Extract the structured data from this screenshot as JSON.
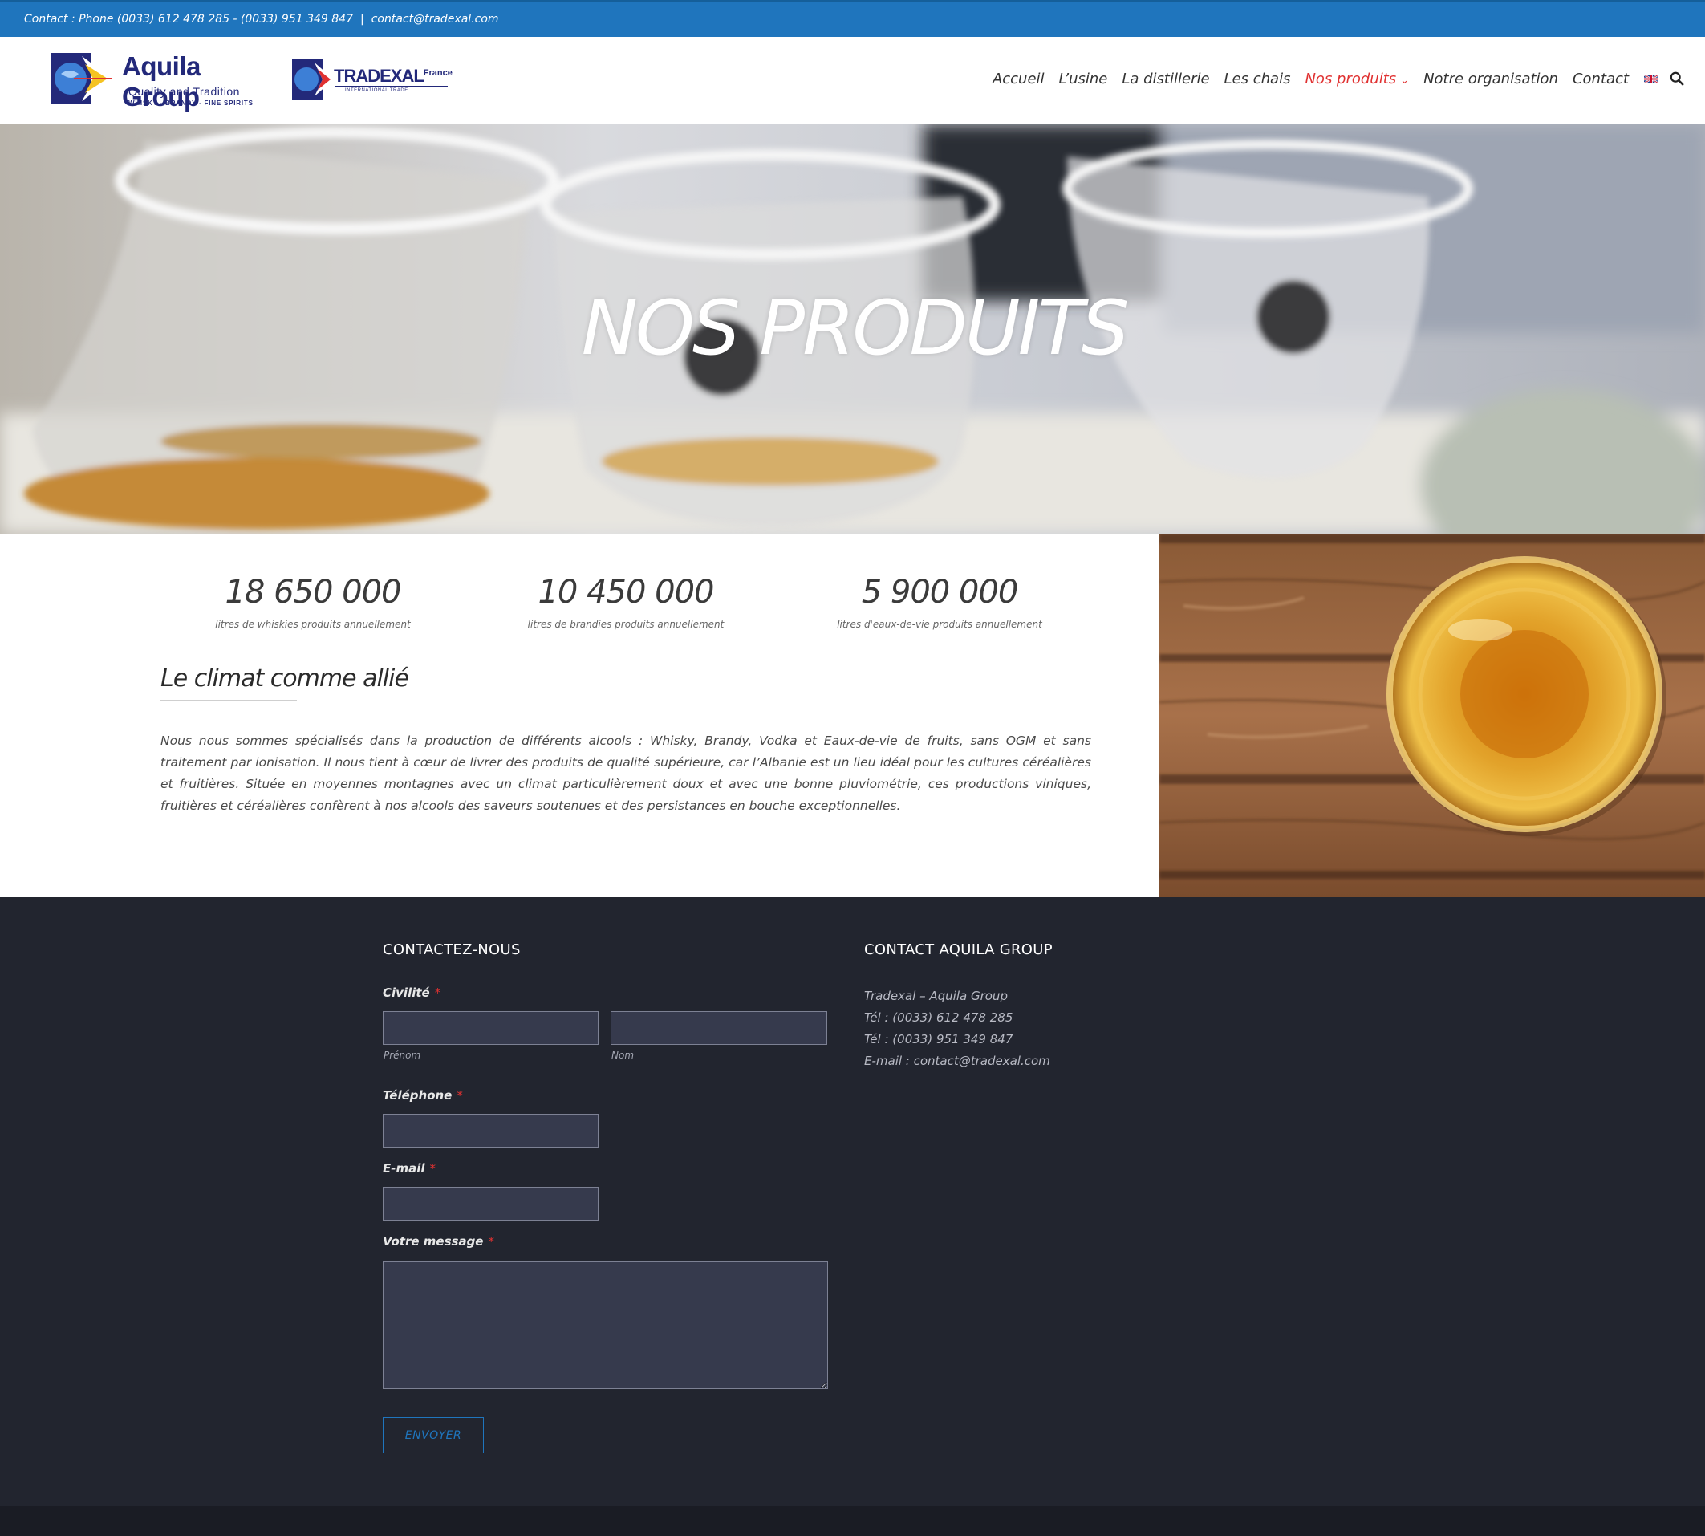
{
  "topbar": {
    "contact_phones": "Contact : Phone (0033) 612 478 285 - (0033) 951 349 847",
    "separator": "|",
    "email": "contact@tradexal.com"
  },
  "header": {
    "logo_aquila": {
      "brand": "Aquila Group",
      "tagline": "Quality and Tradition",
      "subline": "WHISKY - BRANDY - FINE SPIRITS"
    },
    "logo_tradexal": {
      "brand": "TRADEXAL",
      "suffix": "France",
      "subline": "INTERNATIONAL TRADE"
    },
    "nav": [
      {
        "label": "Accueil",
        "active": false
      },
      {
        "label": "L’usine",
        "active": false
      },
      {
        "label": "La distillerie",
        "active": false
      },
      {
        "label": "Les chais",
        "active": false
      },
      {
        "label": "Nos produits",
        "active": true,
        "dropdown": true
      },
      {
        "label": "Notre organisation",
        "active": false
      },
      {
        "label": "Contact",
        "active": false
      }
    ],
    "language_icon": "uk-flag-icon",
    "search_icon": "search-icon",
    "active_color": "#e03131"
  },
  "hero": {
    "title": "NOS PRODUITS"
  },
  "stats": [
    {
      "value": "18 650 000",
      "label": "litres de whiskies produits annuellement"
    },
    {
      "value": "10 450 000",
      "label": "litres de brandies produits annuellement"
    },
    {
      "value": "5 900 000",
      "label": "litres d'eaux-de-vie produits annuellement"
    }
  ],
  "section": {
    "title": "Le climat comme allié",
    "text": "Nous nous sommes spécialisés dans la production de différents alcools : Whisky, Brandy, Vodka et Eaux-de-vie de fruits, sans OGM et sans traitement par ionisation. Il nous tient à cœur de livrer des produits de qualité supérieure, car l’Albanie est un lieu idéal pour les cultures céréalières et fruitières. Située en moyennes montagnes avec un climat particulièrement doux et avec une bonne pluviométrie, ces productions viniques, fruitières et céréalières confèrent à nos alcools des saveurs soutenues et des persistances en bouche exceptionnelles."
  },
  "footer": {
    "form": {
      "heading": "CONTACTEZ-NOUS",
      "civility_label": "Civilité",
      "required_mark": "*",
      "firstname_sub": "Prénom",
      "lastname_sub": "Nom",
      "firstname_value": "",
      "lastname_value": "",
      "phone_label": "Téléphone",
      "phone_value": "",
      "email_label": "E-mail",
      "email_value": "",
      "message_label": "Votre message",
      "message_value": "",
      "submit_label": "ENVOYER"
    },
    "contact": {
      "heading": "CONTACT AQUILA GROUP",
      "lines": [
        "Tradexal – Aquila Group",
        "Tél : (0033) 612 478 285",
        "Tél : (0033) 951 349 847",
        "E-mail : contact@tradexal.com"
      ]
    }
  },
  "colors": {
    "topbar": "#1f75bd",
    "footer": "#22252f",
    "input_bg": "#363a4d",
    "accent_red": "#e03131"
  }
}
